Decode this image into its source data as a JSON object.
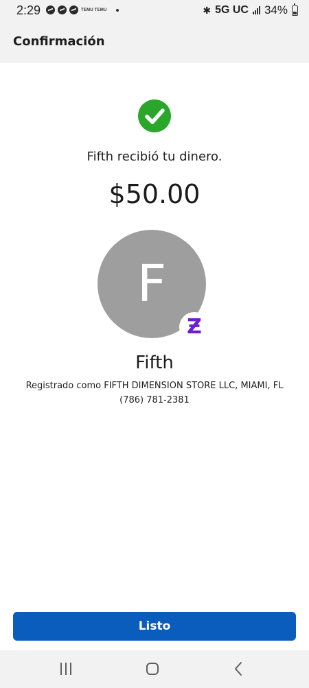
{
  "status_bar": {
    "time": "2:29",
    "temu_label": "TEMU TEMU",
    "network": "5G UC",
    "battery": "34%"
  },
  "header": {
    "title": "Confirmación"
  },
  "confirmation": {
    "message": "Fifth recibió tu dinero.",
    "amount": "$50.00",
    "avatar_initial": "F",
    "badge_icon": "zelle-icon",
    "recipient_name": "Fifth",
    "registered_as": "Registrado como FIFTH DIMENSION STORE LLC, MIAMI, FL",
    "phone": "(786) 781-2381"
  },
  "actions": {
    "done_label": "Listo"
  },
  "colors": {
    "success": "#2aa62a",
    "primary_button": "#0a5dbd",
    "zelle": "#6d1ed4",
    "avatar": "#9e9e9e"
  }
}
